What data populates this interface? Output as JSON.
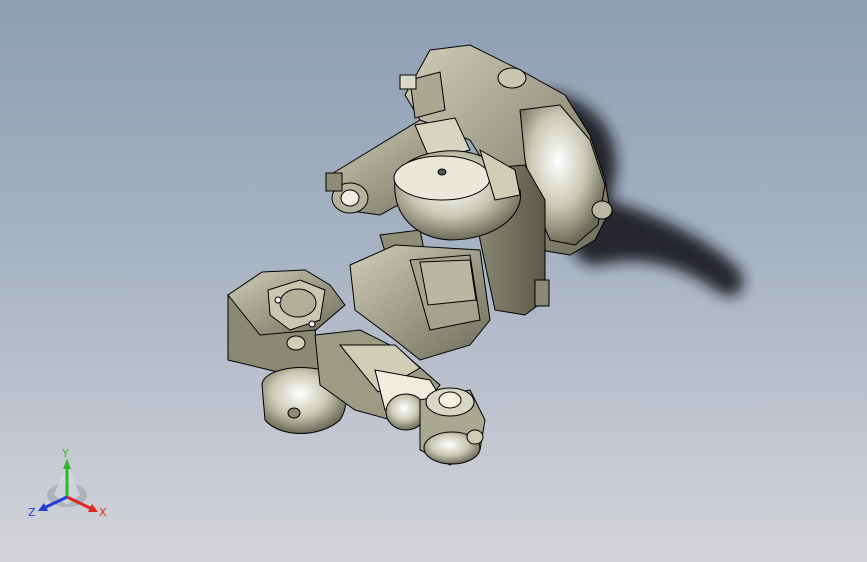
{
  "viewport": {
    "background_top": "#8e9eb3",
    "background_bottom": "#d3d4d9"
  },
  "model": {
    "body_color": "#9c9b83",
    "highlight_color": "#ffffff",
    "shadow_color": "#1a1c1e",
    "edge_color": "#000000"
  },
  "triad": {
    "x_label": "X",
    "y_label": "Y",
    "z_label": "Z",
    "x_color": "#e0271f",
    "y_color": "#2fb82a",
    "z_color": "#1f3fd8"
  }
}
